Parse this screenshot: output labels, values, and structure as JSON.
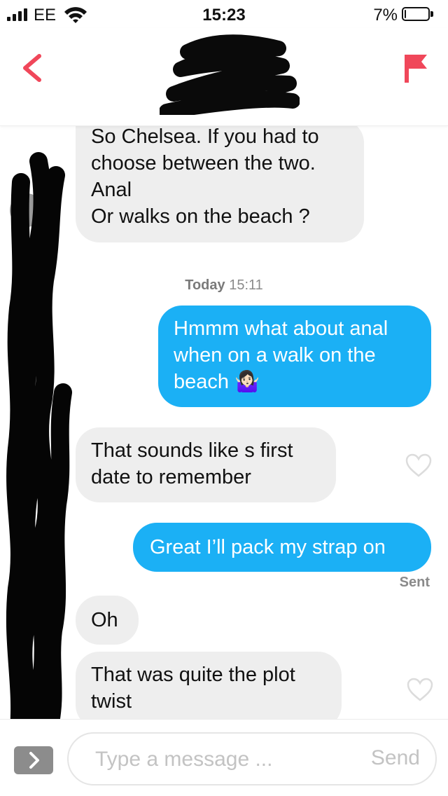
{
  "status_bar": {
    "carrier": "EE",
    "time": "15:23",
    "battery_percent_label": "7%",
    "battery_level": 0.07
  },
  "header": {
    "back_icon": "chevron-left-icon",
    "report_icon": "flag-icon",
    "accent_color": "#f0475a"
  },
  "messages": [
    {
      "direction": "received",
      "text": "So Chelsea. If you had to\nchoose between the two.\nAnal\nOr walks on the beach ?"
    },
    {
      "type": "timestamp",
      "day": "Today",
      "time": "15:11"
    },
    {
      "direction": "sent",
      "text": "Hmmm what about anal\nwhen on a walk on the\nbeach 🤷🏻‍♀️"
    },
    {
      "direction": "received",
      "text": "That sounds like s first\ndate to remember",
      "like_icon": "heart-outline-icon"
    },
    {
      "direction": "sent",
      "text": "Great I’ll pack my strap on",
      "status": "Sent"
    },
    {
      "direction": "received",
      "text": "Oh"
    },
    {
      "direction": "received",
      "text": "That was quite the plot\ntwist",
      "like_icon": "heart-outline-icon"
    }
  ],
  "composer": {
    "placeholder": "Type a message ...",
    "send_label": "Send",
    "expand_icon": "chevron-right-icon"
  },
  "colors": {
    "sent_bubble": "#1bb0f5",
    "received_bubble": "#eeeeee",
    "accent": "#f0475a"
  }
}
